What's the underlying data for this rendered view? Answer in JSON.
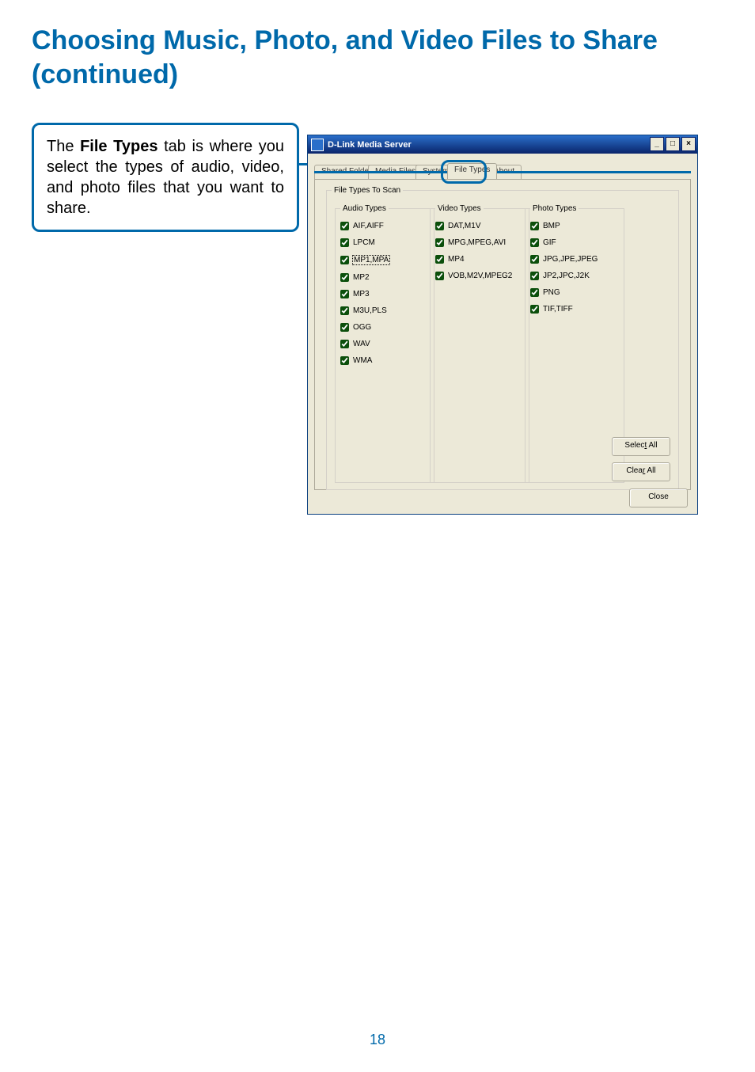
{
  "page_title": "Choosing Music, Photo, and Video Files to Share (continued)",
  "callout": {
    "pre": "The ",
    "bold": "File Types",
    "post": " tab is where you select the types of audio, video, and photo files that you want to share."
  },
  "page_number": "18",
  "window": {
    "title": "D-Link Media Server",
    "minimize_glyph": "_",
    "maximize_glyph": "□",
    "close_glyph": "×"
  },
  "tabs": {
    "shared_folder": "Shared Folder",
    "media_files": "Media Files",
    "system": "System",
    "file_types": "File Types",
    "about": "About"
  },
  "groups": {
    "outer": "File Types To Scan",
    "audio": "Audio Types",
    "video": "Video Types",
    "photo": "Photo Types"
  },
  "audio": {
    "aif": "AIF,AIFF",
    "lpcm": "LPCM",
    "mp1": "MP1,MPA",
    "mp2": "MP2",
    "mp3": "MP3",
    "m3u": "M3U,PLS",
    "ogg": "OGG",
    "wav": "WAV",
    "wma": "WMA"
  },
  "video": {
    "dat": "DAT,M1V",
    "mpg": "MPG,MPEG,AVI",
    "mp4": "MP4",
    "vob": "VOB,M2V,MPEG2"
  },
  "photo": {
    "bmp": "BMP",
    "gif": "GIF",
    "jpg": "JPG,JPE,JPEG",
    "jp2": "JP2,JPC,J2K",
    "png": "PNG",
    "tif": "TIF,TIFF"
  },
  "buttons": {
    "select_all_pre": "Selec",
    "select_all_u": "t",
    "select_all_post": " All",
    "clear_all_pre": "Clea",
    "clear_all_u": "r",
    "clear_all_post": " All",
    "close": "Close"
  }
}
